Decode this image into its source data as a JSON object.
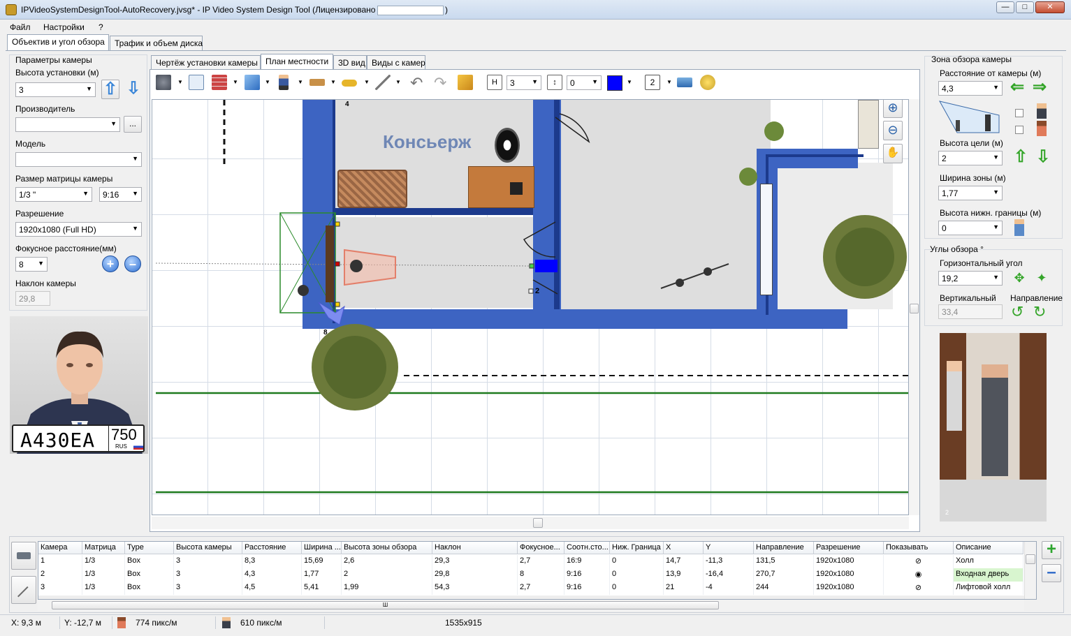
{
  "window": {
    "title": "IPVideoSystemDesignTool-AutoRecovery.jvsg* - IP Video System Design Tool (Лицензировано",
    "close_paren": ")"
  },
  "menu": [
    "Файл",
    "Настройки",
    "?"
  ],
  "main_tabs": [
    "Объектив и угол обзора",
    "Трафик и объем диска"
  ],
  "left": {
    "camera_params": "Параметры камеры",
    "height_label": "Высота установки (м)",
    "height_value": "3",
    "manufacturer_label": "Производитель",
    "manufacturer_value": "",
    "browse_button": "...",
    "model_label": "Модель",
    "model_value": "",
    "sensor_label": "Размер матрицы камеры",
    "sensor_value": "1/3 \"",
    "aspect_value": "9:16",
    "resolution_label": "Разрешение",
    "resolution_value": "1920x1080 (Full HD)",
    "focal_label": "Фокусное расстояние(мм)",
    "focal_value": "8",
    "tilt_label": "Наклон камеры",
    "tilt_value": "29,8",
    "plate_text": "A430EA",
    "plate_region": "750",
    "plate_country": "RUS"
  },
  "view_tabs": [
    "Чертёж установки камеры",
    "План местности",
    "3D вид",
    "Виды с камер"
  ],
  "toolbar": {
    "wall_height": "3",
    "wall_offset": "0",
    "line_width": "2",
    "color": "#0000ff"
  },
  "map": {
    "room_label": "Консьерж",
    "marker_4": "4",
    "marker_2": "2",
    "marker_8": "8"
  },
  "right": {
    "zone_title": "Зона обзора камеры",
    "distance_label": "Расстояние от камеры (м)",
    "distance_value": "4,3",
    "target_height_label": "Высота цели (м)",
    "target_height_value": "2",
    "zone_width_label": "Ширина зоны (м)",
    "zone_width_value": "1,77",
    "lower_bound_label": "Высота нижн. границы (м)",
    "lower_bound_value": "0",
    "angles_title": "Углы обзора °",
    "horizontal_label": "Горизонтальный угол",
    "horizontal_value": "19,2",
    "vertical_label": "Вертикальный",
    "vertical_value": "33,4",
    "direction_label": "Направление",
    "preview_index": "2"
  },
  "table": {
    "columns": [
      "Камера",
      "Матрица",
      "Type",
      "Высота камеры",
      "Расстояние",
      "Ширина ...",
      "Высота зоны обзора",
      "Наклон",
      "Фокусное...",
      "Соотн.сто...",
      "Ниж. Граница",
      "X",
      "Y",
      "Направление",
      "Разрешение",
      "Показывать",
      "Описание"
    ],
    "rows": [
      [
        "1",
        "1/3",
        "Box",
        "3",
        "8,3",
        "15,69",
        "2,6",
        "29,3",
        "2,7",
        "16:9",
        "0",
        "14,7",
        "-11,3",
        "131,5",
        "1920x1080",
        "hidden",
        "Холл"
      ],
      [
        "2",
        "1/3",
        "Box",
        "3",
        "4,3",
        "1,77",
        "2",
        "29,8",
        "8",
        "9:16",
        "0",
        "13,9",
        "-16,4",
        "270,7",
        "1920x1080",
        "visible",
        "Входная дверь"
      ],
      [
        "3",
        "1/3",
        "Box",
        "3",
        "4,5",
        "5,41",
        "1,99",
        "54,3",
        "2,7",
        "9:16",
        "0",
        "21",
        "-4",
        "244",
        "1920x1080",
        "hidden",
        "Лифтовой холл"
      ]
    ],
    "scroll_mark": "Ш"
  },
  "status": {
    "x": "X: 9,3 м",
    "y": "Y: -12,7 м",
    "px1": "774 пикс/м",
    "px2": "610 пикс/м",
    "size": "1535x915"
  }
}
